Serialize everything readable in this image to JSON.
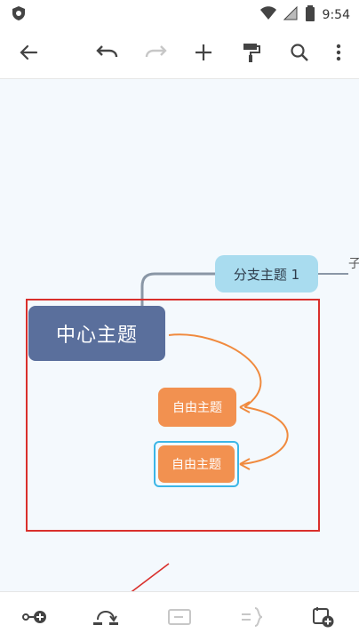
{
  "status_bar": {
    "time": "9:54",
    "icons": [
      "shield-icon",
      "wifi-icon",
      "signal-icon",
      "battery-icon"
    ]
  },
  "toolbar": {
    "buttons": [
      "back-icon",
      "undo-icon",
      "redo-icon",
      "add-icon",
      "format-painter-icon",
      "search-icon",
      "more-icon"
    ]
  },
  "mindmap": {
    "central_topic": "中心主题",
    "branch_topic": "分支主题 1",
    "sub_topic_partial": "子",
    "free_topic_1": "自由主题",
    "free_topic_2": "自由主题"
  },
  "bottom_bar": {
    "buttons": [
      "add-node-icon",
      "relationship-icon",
      "summary-icon",
      "boundary-icon",
      "insert-icon"
    ]
  },
  "colors": {
    "central": "#5a6f9c",
    "branch": "#a9dcef",
    "free": "#f29150",
    "relationship_line": "#f08a3e",
    "selection": "#3cb6e6",
    "annotation": "#d9302c"
  }
}
